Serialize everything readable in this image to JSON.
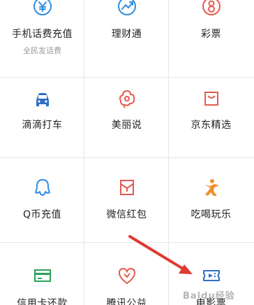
{
  "grid": {
    "items": [
      {
        "label": "手机话费充值",
        "sublabel": "全民发话费",
        "icon": "yuan-circle-icon",
        "color": "#2f8ee0"
      },
      {
        "label": "理财通",
        "icon": "trend-chart-icon",
        "color": "#2f8ee0"
      },
      {
        "label": "彩票",
        "icon": "lottery-icon",
        "color": "#e55a4f"
      },
      {
        "label": "滴滴打车",
        "icon": "taxi-icon",
        "color": "#2f6fc4"
      },
      {
        "label": "美丽说",
        "icon": "flower-icon",
        "color": "#e55a4f"
      },
      {
        "label": "京东精选",
        "icon": "shopping-bag-icon",
        "color": "#e55a4f"
      },
      {
        "label": "Q币充值",
        "icon": "qq-penguin-icon",
        "color": "#2f8ee0"
      },
      {
        "label": "微信红包",
        "icon": "red-envelope-icon",
        "color": "#e55a4f"
      },
      {
        "label": "吃喝玩乐",
        "icon": "person-fun-icon",
        "color": "#f0902a"
      },
      {
        "label": "信用卡还款",
        "icon": "credit-card-icon",
        "color": "#2aa35a"
      },
      {
        "label": "腾讯公益",
        "icon": "heart-icon",
        "color": "#e55a4f"
      },
      {
        "label": "电影票",
        "icon": "movie-ticket-icon",
        "color": "#2f6fc4"
      }
    ]
  },
  "watermark": "Baidu经验",
  "annotation_color": "#e03a2f"
}
